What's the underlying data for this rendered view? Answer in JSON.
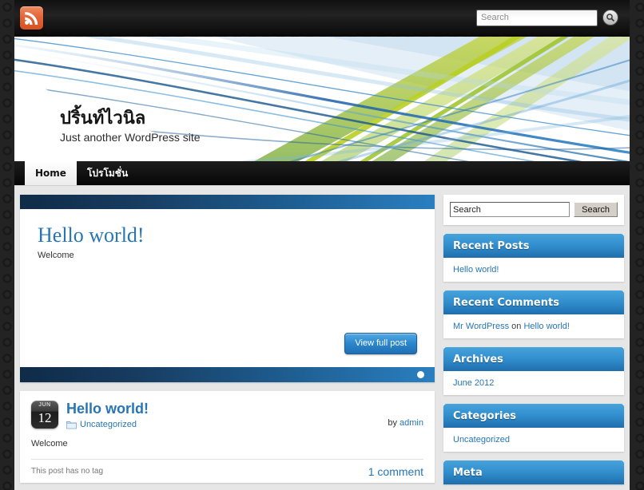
{
  "topbar": {
    "rss_icon": "rss-feed-icon",
    "search_placeholder": "Search",
    "search_value": "",
    "search_button_icon": "magnifier-icon"
  },
  "header": {
    "site_title": "ปริ้นท์ไวนิล",
    "tagline": "Just another WordPress site",
    "banner_colors": [
      "#1c5ea8",
      "#2f86c8",
      "#8fb63a",
      "#c9d62a",
      "#ffffff"
    ]
  },
  "nav": {
    "items": [
      {
        "label": "Home",
        "active": true
      },
      {
        "label": "โปรโมชั่น",
        "active": false
      }
    ]
  },
  "slider": {
    "title": "Hello world!",
    "excerpt": "Welcome",
    "button_label": "View full post",
    "pagination_dots": 1,
    "active_dot": 1,
    "bar_gradient": [
      "#0f2b48",
      "#2a7fc0"
    ]
  },
  "post": {
    "date_month": "JUN",
    "date_day": "12",
    "title": "Hello world!",
    "category_icon": "folder-icon",
    "category": "Uncategorized",
    "author_prefix": "by",
    "author": "admin",
    "body": "Welcome",
    "tag_text": "This post has no tag",
    "comments": "1 comment"
  },
  "sidebar": {
    "search": {
      "value": "Search",
      "placeholder": "Search",
      "button_label": "Search"
    },
    "widgets": [
      {
        "title": "Recent Posts",
        "items": [
          {
            "text": "Hello world!",
            "link": true
          }
        ]
      },
      {
        "title": "Recent Comments",
        "items": [
          {
            "author": "Mr WordPress",
            "sep": "on",
            "post": "Hello world!"
          }
        ]
      },
      {
        "title": "Archives",
        "items": [
          {
            "text": "June 2012",
            "link": true
          }
        ]
      },
      {
        "title": "Categories",
        "items": [
          {
            "text": "Uncategorized",
            "link": true
          }
        ]
      },
      {
        "title": "Meta",
        "items": []
      }
    ]
  },
  "colors": {
    "accent_blue": "#2775b5",
    "widget_header_top": "#46a3da",
    "widget_header_bottom": "#1f6ead",
    "rss_orange": "#e2663a",
    "content_bg": "#e6e6e6",
    "frame_dark": "#232323"
  }
}
